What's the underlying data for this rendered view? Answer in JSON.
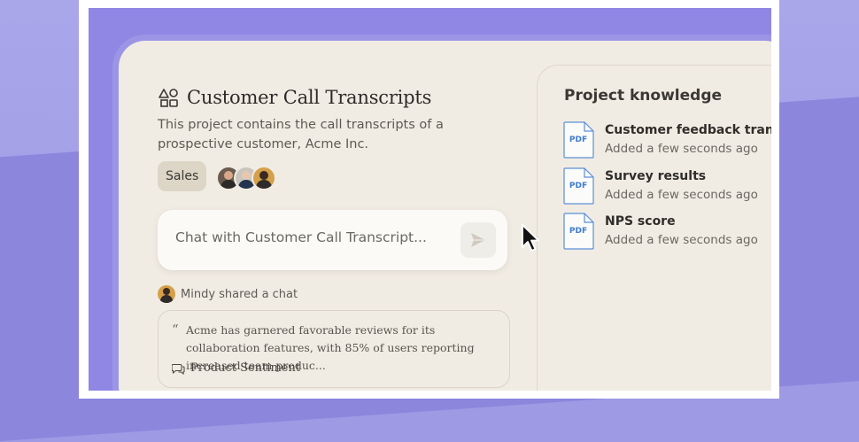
{
  "project": {
    "title": "Customer Call Transcripts",
    "description": "This project contains the call transcripts of a prospective customer, Acme Inc.",
    "tag": "Sales",
    "avatars": [
      "member-1",
      "member-2",
      "member-3"
    ]
  },
  "chat": {
    "placeholder": "Chat with Customer Call Transcript..."
  },
  "activity": {
    "shared_text": "Mindy shared a chat",
    "quote_mark": "“",
    "quote": "Acme has garnered favorable reviews for its collaboration features, with 85% of users reporting increased team produc...",
    "chat_title": "Product Sentiment"
  },
  "knowledge": {
    "title": "Project knowledge",
    "files": [
      {
        "name": "Customer feedback transcripts",
        "meta": "Added a few seconds ago",
        "type": "PDF"
      },
      {
        "name": "Survey results",
        "meta": "Added a few seconds ago",
        "type": "PDF"
      },
      {
        "name": "NPS score",
        "meta": "Added a few seconds ago",
        "type": "PDF"
      }
    ]
  },
  "icons": {
    "project": "shapes-icon",
    "send": "send-icon",
    "chat": "chat-bubbles-icon",
    "file": "pdf-file-icon",
    "cursor": "mouse-pointer-icon"
  },
  "colors": {
    "background": "#9e9ae4",
    "app_surface": "#f1ece3",
    "tag_bg": "#ddd6c7",
    "pdf_accent": "#3f7bd0"
  }
}
